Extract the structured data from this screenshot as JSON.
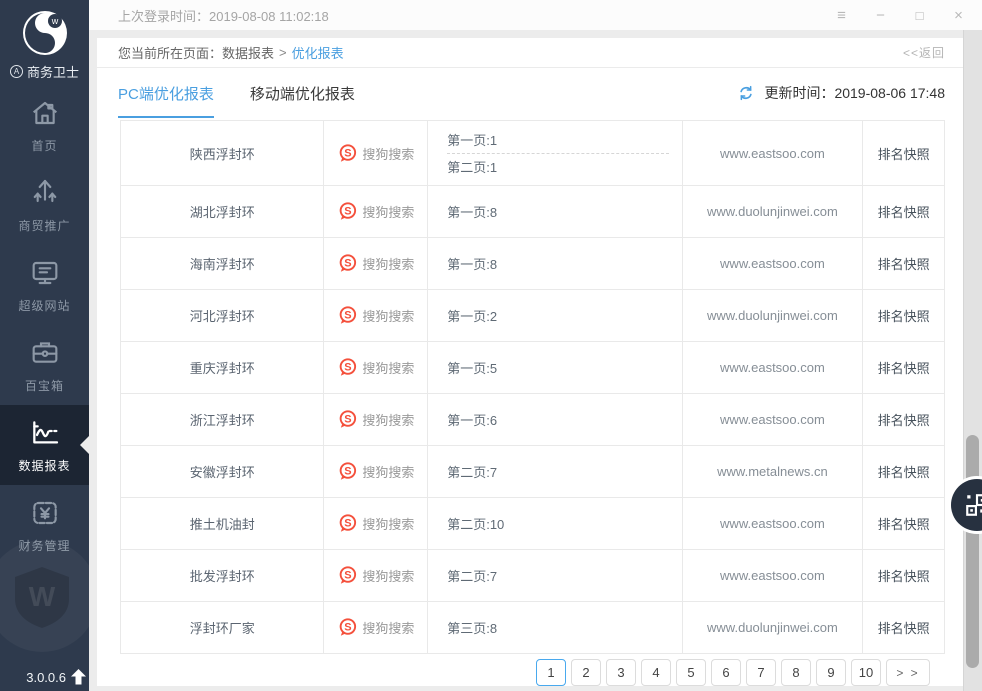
{
  "titlebar": {
    "last_login": "上次登录时间：2019-08-08 11:02:18",
    "controls": {
      "menu": "≡",
      "minimize": "−",
      "maximize": "□",
      "close": "×"
    }
  },
  "sidebar": {
    "brand": "商务卫士",
    "items": [
      {
        "name": "home",
        "icon": "home-icon",
        "label": "首页",
        "active": false
      },
      {
        "name": "promotion",
        "icon": "promote-icon",
        "label": "商贸推广",
        "active": false
      },
      {
        "name": "super-website",
        "icon": "monitor-icon",
        "label": "超级网站",
        "active": false
      },
      {
        "name": "toolbox",
        "icon": "toolbox-icon",
        "label": "百宝箱",
        "active": false
      },
      {
        "name": "data-report",
        "icon": "chart-icon",
        "label": "数据报表",
        "active": true
      },
      {
        "name": "finance",
        "icon": "finance-icon",
        "label": "财务管理",
        "active": false
      }
    ],
    "version": "3.0.0.6"
  },
  "breadcrumb": {
    "prefix": "您当前所在页面：",
    "parent": "数据报表",
    "separator": ">",
    "current": "优化报表",
    "back": "<<返回"
  },
  "toolbar": {
    "tabs": [
      {
        "label": "PC端优化报表",
        "active": true
      },
      {
        "label": "移动端优化报表",
        "active": false
      }
    ],
    "update_time": "更新时间：2019-08-06 17:48"
  },
  "table": {
    "rows": [
      {
        "keyword": "陕西浮封环",
        "engine": "搜狗搜索",
        "ranks": [
          "第一页:1",
          "第二页:1"
        ],
        "website": "www.eastsoo.com",
        "snapshot": "排名快照"
      },
      {
        "keyword": "湖北浮封环",
        "engine": "搜狗搜索",
        "ranks": [
          "第一页:8"
        ],
        "website": "www.duolunjinwei.com",
        "snapshot": "排名快照"
      },
      {
        "keyword": "海南浮封环",
        "engine": "搜狗搜索",
        "ranks": [
          "第一页:8"
        ],
        "website": "www.eastsoo.com",
        "snapshot": "排名快照"
      },
      {
        "keyword": "河北浮封环",
        "engine": "搜狗搜索",
        "ranks": [
          "第一页:2"
        ],
        "website": "www.duolunjinwei.com",
        "snapshot": "排名快照"
      },
      {
        "keyword": "重庆浮封环",
        "engine": "搜狗搜索",
        "ranks": [
          "第一页:5"
        ],
        "website": "www.eastsoo.com",
        "snapshot": "排名快照"
      },
      {
        "keyword": "浙江浮封环",
        "engine": "搜狗搜索",
        "ranks": [
          "第一页:6"
        ],
        "website": "www.eastsoo.com",
        "snapshot": "排名快照"
      },
      {
        "keyword": "安徽浮封环",
        "engine": "搜狗搜索",
        "ranks": [
          "第二页:7"
        ],
        "website": "www.metalnews.cn",
        "snapshot": "排名快照"
      },
      {
        "keyword": "推土机油封",
        "engine": "搜狗搜索",
        "ranks": [
          "第二页:10"
        ],
        "website": "www.eastsoo.com",
        "snapshot": "排名快照"
      },
      {
        "keyword": "批发浮封环",
        "engine": "搜狗搜索",
        "ranks": [
          "第二页:7"
        ],
        "website": "www.eastsoo.com",
        "snapshot": "排名快照"
      },
      {
        "keyword": "浮封环厂家",
        "engine": "搜狗搜索",
        "ranks": [
          "第三页:8"
        ],
        "website": "www.duolunjinwei.com",
        "snapshot": "排名快照"
      }
    ]
  },
  "pagination": {
    "pages": [
      "1",
      "2",
      "3",
      "4",
      "5",
      "6",
      "7",
      "8",
      "9",
      "10"
    ],
    "active": "1",
    "next": "> >"
  },
  "colors": {
    "accent_blue": "#4a9fe0",
    "pagination_active_border": "#49a9ee",
    "sogou_red": "#f4503c",
    "sidebar_bg": "#2e3a4d",
    "sidebar_active_bg": "#1c2533"
  }
}
